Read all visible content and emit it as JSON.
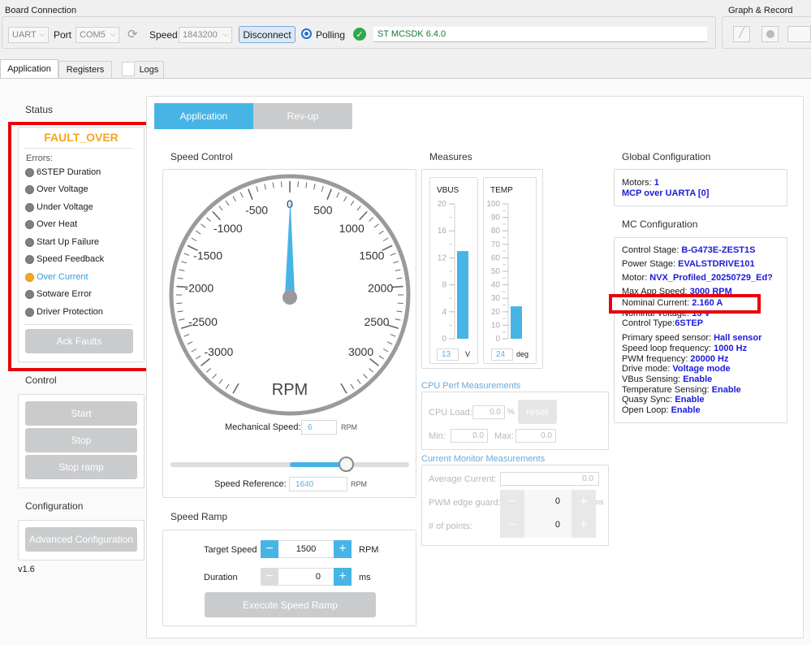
{
  "top": {
    "board_connection": "Board Connection",
    "protocol": "UART",
    "port_label": "Port",
    "port": "COM5",
    "speed_label": "Speed",
    "baud": "1843200",
    "disconnect": "Disconnect",
    "polling": "Polling",
    "sdk": "ST MCSDK 6.4.0",
    "graph_record": "Graph & Record"
  },
  "tabs": [
    "Application",
    "Registers",
    "Logs"
  ],
  "left": {
    "status": "Status",
    "fault": "FAULT_OVER",
    "errors_label": "Errors:",
    "errors": [
      "6STEP Duration",
      "Over Voltage",
      "Under Voltage",
      "Over Heat",
      "Start Up Failure",
      "Speed Feedback",
      "Over Current",
      "Sotware Error",
      "Driver Protection"
    ],
    "active_error": "Over Current",
    "ack": "Ack Faults",
    "control": "Control",
    "start": "Start",
    "stop": "Stop",
    "stop_ramp": "Stop ramp",
    "configuration": "Configuration",
    "advanced": "Advanced Configuration",
    "version": "v1.6"
  },
  "subtabs": [
    "Application",
    "Rev-up"
  ],
  "speed": {
    "title": "Speed Control",
    "unit": "RPM",
    "ticks": [
      "-3000",
      "-2500",
      "-2000",
      "-1500",
      "-1000",
      "-500",
      "0",
      "500",
      "1000",
      "1500",
      "2000",
      "2500",
      "3000"
    ],
    "gauge_min": -3500,
    "gauge_max": 3500,
    "value": 6,
    "mech_label": "Mechanical Speed:",
    "mech_value": "6",
    "mech_unit": "RPM",
    "ref_label": "Speed Reference:",
    "ref_value": "1640",
    "ref_unit": "RPM",
    "slider_value": 1640
  },
  "ramp": {
    "title": "Speed Ramp",
    "target_label": "Target Speed",
    "target": "1500",
    "target_unit": "RPM",
    "duration_label": "Duration",
    "duration": "0",
    "duration_unit": "ms",
    "execute": "Execute Speed Ramp"
  },
  "measures": {
    "title": "Measures",
    "vbus": {
      "label": "VBUS",
      "ticks": [
        "20",
        "16",
        "12",
        "8",
        "4",
        "0"
      ],
      "max": 20,
      "value": 13,
      "display": "13",
      "unit": "V"
    },
    "temp": {
      "label": "TEMP",
      "ticks": [
        "100",
        "90",
        "80",
        "70",
        "60",
        "50",
        "40",
        "30",
        "20",
        "10",
        "0"
      ],
      "max": 100,
      "value": 24,
      "display": "24",
      "unit": "deg"
    },
    "cpu_title": "CPU Perf Measurements",
    "cpu_load": "CPU Load:",
    "cpu_val": "0.0",
    "pct": "%",
    "reset": "reset",
    "min": "Min:",
    "min_val": "0.0",
    "max": "Max:",
    "max_val": "0.0",
    "cur_title": "Current Monitor Measurements",
    "avg": "Average Current:",
    "avg_val": "0.0",
    "pwm": "PWM edge guard:",
    "pwm_val": "0",
    "pwm_unit": "ns",
    "points": "# of points:",
    "points_val": "0"
  },
  "global": {
    "title": "Global Configuration",
    "motors_k": "Motors:",
    "motors_v": "1",
    "mcp": "MCP over UARTA [0]"
  },
  "mc": {
    "title": "MC Configuration",
    "items": [
      {
        "k": "Control Stage:",
        "v": "B-G473E-ZEST1S"
      },
      {
        "k": "Power Stage:",
        "v": "EVALSTDRIVE101"
      },
      {
        "k": "Motor:",
        "v": "NVX_Profiled_20250729_Ed?"
      },
      {
        "k": "Max App Speed:",
        "v": "3000 RPM"
      },
      {
        "k": "Nominal Current:",
        "v": "2.160 A"
      },
      {
        "k": "Nominal Voltage:",
        "v": "13 V"
      },
      {
        "k": "Control Type:",
        "v": "6STEP"
      },
      {
        "k": "Primary speed sensor:",
        "v": "Hall sensor"
      },
      {
        "k": "Speed loop frequency:",
        "v": "1000 Hz"
      },
      {
        "k": "PWM frequency:",
        "v": "20000 Hz"
      },
      {
        "k": "Drive mode:",
        "v": "Voltage mode"
      },
      {
        "k": "VBus Sensing:",
        "v": "Enable"
      },
      {
        "k": "Temperature Sensing:",
        "v": "Enable"
      },
      {
        "k": "Quasy Sync:",
        "v": "Enable"
      },
      {
        "k": "Open Loop:",
        "v": "Enable"
      }
    ]
  },
  "colors": {
    "accent": "#47b4e6",
    "fault": "#f5a623",
    "highlight": "#e8000a",
    "link": "#1a1adc"
  }
}
